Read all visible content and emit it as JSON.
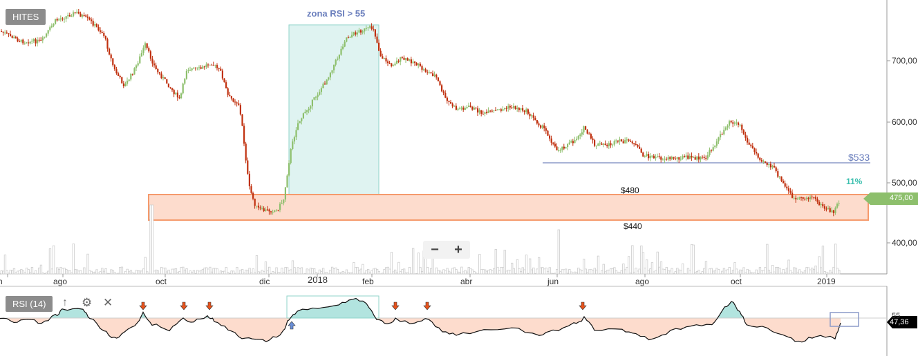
{
  "symbol": "HITES",
  "annotation_title": "zona RSI > 55",
  "levels": {
    "resistance": "$533",
    "top": "$480",
    "bottom": "$440",
    "pct": "11%"
  },
  "price_axis": [
    "700,00",
    "600,00",
    "500,00",
    "400,00"
  ],
  "current_price": "475,00",
  "time_axis": [
    "n",
    "ago",
    "oct",
    "dic",
    "2018",
    "feb",
    "abr",
    "jun",
    "ago",
    "oct",
    "2019"
  ],
  "indicator": {
    "label": "RSI (14)",
    "level": "55",
    "value": "47,36"
  },
  "zoom": {
    "out": "−",
    "in": "+"
  },
  "colors": {
    "up": "#8dbf6c",
    "down": "#c0300e",
    "zone": "#fddccd",
    "rsi_zone": "#b2e4df",
    "line": "#7b8fc7"
  }
}
